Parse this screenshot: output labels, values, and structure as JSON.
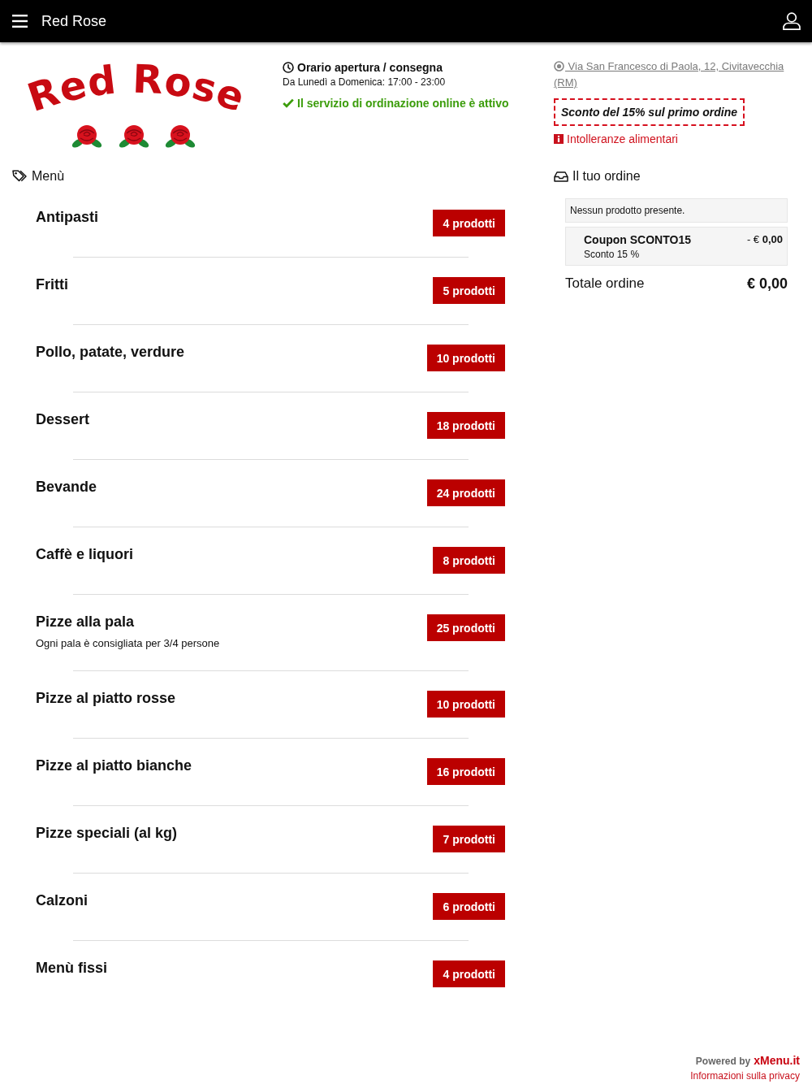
{
  "header": {
    "title": "Red Rose"
  },
  "logo": {
    "text": "Red Rose"
  },
  "hours": {
    "title": "Orario apertura / consegna",
    "schedule": "Da Lunedì a Domenica: 17:00 - 23:00",
    "status": "Il servizio di ordinazione online è attivo"
  },
  "info": {
    "address": "Via San Francesco di Paola, 12, Civitavecchia (RM)",
    "promo": "Sconto del 15% sul primo ordine",
    "allergens": "Intolleranze alimentari"
  },
  "menu": {
    "title": "Menù",
    "categories": [
      {
        "name": "Antipasti",
        "count": "4 prodotti"
      },
      {
        "name": "Fritti",
        "count": "5 prodotti"
      },
      {
        "name": "Pollo, patate, verdure",
        "count": "10 prodotti"
      },
      {
        "name": "Dessert",
        "count": "18 prodotti"
      },
      {
        "name": "Bevande",
        "count": "24 prodotti"
      },
      {
        "name": "Caffè e liquori",
        "count": "8 prodotti"
      },
      {
        "name": "Pizze alla pala",
        "description": "Ogni pala è consigliata per 3/4 persone",
        "count": "25 prodotti"
      },
      {
        "name": "Pizze al piatto rosse",
        "count": "10 prodotti"
      },
      {
        "name": "Pizze al piatto bianche",
        "count": "16 prodotti"
      },
      {
        "name": "Pizze speciali (al kg)",
        "count": "7 prodotti"
      },
      {
        "name": "Calzoni",
        "count": "6 prodotti"
      },
      {
        "name": "Menù fissi",
        "count": "4 prodotti"
      }
    ]
  },
  "order": {
    "title": "Il tuo ordine",
    "empty_message": "Nessun prodotto presente.",
    "coupon": {
      "name": "Coupon SCONTO15",
      "detail": "Sconto 15 %",
      "amount": "- € **0,00**"
    },
    "total_label": "Totale ordine",
    "total": "€ 0,00"
  },
  "footer": {
    "powered_by": "Powered by",
    "brand": "xMenu.it",
    "privacy": "Informazioni sulla privacy"
  }
}
